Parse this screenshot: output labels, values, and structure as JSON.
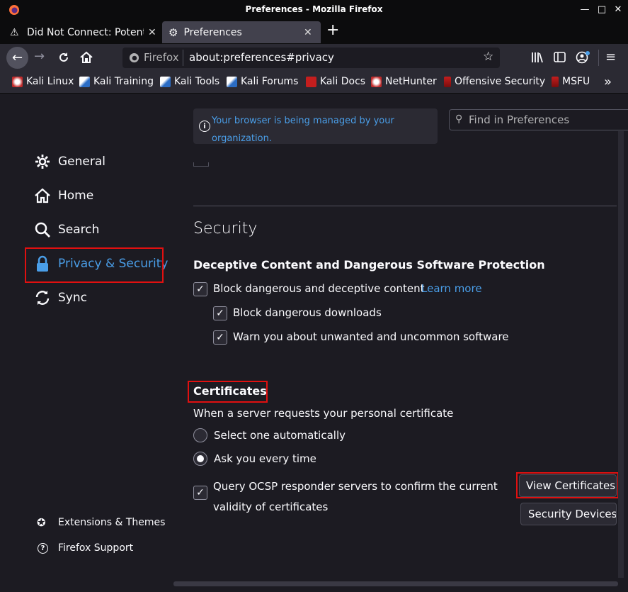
{
  "window": {
    "title": "Preferences - Mozilla Firefox"
  },
  "tabs": [
    {
      "label": "Did Not Connect: Potenti",
      "icon": "warning-icon"
    },
    {
      "label": "Preferences",
      "icon": "gear-icon"
    }
  ],
  "urlbar": {
    "identity": "Firefox",
    "url": "about:preferences#privacy"
  },
  "bookmarks": [
    {
      "label": "Kali Linux"
    },
    {
      "label": "Kali Training"
    },
    {
      "label": "Kali Tools"
    },
    {
      "label": "Kali Forums"
    },
    {
      "label": "Kali Docs"
    },
    {
      "label": "NetHunter"
    },
    {
      "label": "Offensive Security"
    },
    {
      "label": "MSFU"
    }
  ],
  "policy_notice": {
    "line1": "Your browser is being managed by your",
    "line2": "organization."
  },
  "search": {
    "placeholder": "Find in Preferences"
  },
  "sidebar": {
    "items": [
      {
        "label": "General",
        "icon": "gear-icon"
      },
      {
        "label": "Home",
        "icon": "home-icon"
      },
      {
        "label": "Search",
        "icon": "search-icon"
      },
      {
        "label": "Privacy & Security",
        "icon": "lock-icon",
        "selected": true
      },
      {
        "label": "Sync",
        "icon": "sync-icon"
      }
    ],
    "footer": [
      {
        "label": "Extensions & Themes",
        "icon": "puzzle-icon"
      },
      {
        "label": "Firefox Support",
        "icon": "help-icon"
      }
    ]
  },
  "security": {
    "heading": "Security",
    "deceptive": {
      "heading": "Deceptive Content and Dangerous Software Protection",
      "block_label": "Block dangerous and deceptive content",
      "learn_more": "Learn more",
      "downloads_label": "Block dangerous downloads",
      "unwanted_label": "Warn you about unwanted and uncommon software"
    },
    "certificates": {
      "heading": "Certificates",
      "intro": "When a server requests your personal certificate",
      "option_auto": "Select one automatically",
      "option_ask": "Ask you every time",
      "ocsp_line1": "Query OCSP responder servers to confirm the current",
      "ocsp_line2": "validity of certificates",
      "view_button": "View Certificates...",
      "devices_button": "Security Devices..."
    }
  },
  "colors": {
    "accent": "#54ffbd",
    "link": "#4a9ee8",
    "highlight": "#e01010",
    "selected": "#4a9ee8"
  }
}
